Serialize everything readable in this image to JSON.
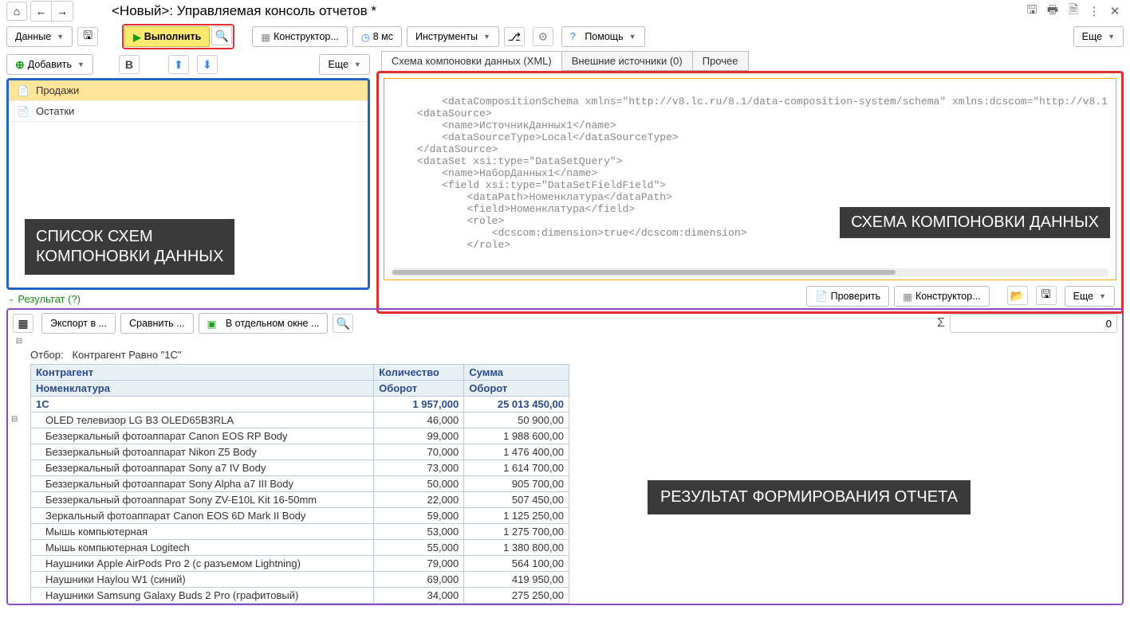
{
  "title": "<Новый>: Управляемая консоль отчетов *",
  "toolbar": {
    "data": "Данные",
    "execute": "Выполнить",
    "constructor": "Конструктор...",
    "time": "8 мс",
    "tools": "Инструменты",
    "help": "Помощь",
    "more": "Еще"
  },
  "leftbar": {
    "add": "Добавить",
    "bold": "B",
    "more": "Еще"
  },
  "schemas": [
    {
      "name": "Продажи",
      "selected": true
    },
    {
      "name": "Остатки",
      "selected": false
    }
  ],
  "overlay_left": "СПИСОК СХЕМ\nКОМПОНОВКИ ДАННЫХ",
  "tabs": {
    "xml": "Схема компоновки данных (XML)",
    "ext": "Внешние источники (0)",
    "other": "Прочее"
  },
  "xml": "<dataCompositionSchema xmlns=\"http://v8.lc.ru/8.1/data-composition-system/schema\" xmlns:dcscom=\"http://v8.1\n    <dataSource>\n        <name>ИсточникДанных1</name>\n        <dataSourceType>Local</dataSourceType>\n    </dataSource>\n    <dataSet xsi:type=\"DataSetQuery\">\n        <name>НаборДанных1</name>\n        <field xsi:type=\"DataSetFieldField\">\n            <dataPath>Номенклатура</dataPath>\n            <field>Номенклатура</field>\n            <role>\n                <dcscom:dimension>true</dcscom:dimension>\n            </role>",
  "overlay_right": "СХЕМА КОМПОНОВКИ ДАННЫХ",
  "xml_toolbar": {
    "check": "Проверить",
    "constructor": "Конструктор...",
    "more": "Еще"
  },
  "result_header": "Результат (?)",
  "result_toolbar": {
    "export": "Экспорт в ...",
    "compare": "Сравнить ...",
    "newwin": "В отдельном окне ...",
    "sum": "0"
  },
  "filter_label": "Отбор:",
  "filter_value": "Контрагент Равно \"1С\"",
  "headers": {
    "c1a": "Контрагент",
    "c1b": "Номенклатура",
    "c2a": "Количество",
    "c2b": "Оборот",
    "c3a": "Сумма",
    "c3b": "Оборот"
  },
  "group": {
    "name": "1С",
    "qty": "1 957,000",
    "sum": "25 013 450,00"
  },
  "rows": [
    {
      "n": "OLED телевизор LG B3 OLED65B3RLA",
      "q": "46,000",
      "s": "50 900,00"
    },
    {
      "n": "Беззеркальный фотоаппарат Canon EOS RP Body",
      "q": "99,000",
      "s": "1 988 600,00"
    },
    {
      "n": "Беззеркальный фотоаппарат Nikon Z5 Body",
      "q": "70,000",
      "s": "1 476 400,00"
    },
    {
      "n": "Беззеркальный фотоаппарат Sony a7 IV Body",
      "q": "73,000",
      "s": "1 614 700,00"
    },
    {
      "n": "Беззеркальный фотоаппарат Sony Alpha a7 III Body",
      "q": "50,000",
      "s": "905 700,00"
    },
    {
      "n": "Беззеркальный фотоаппарат Sony ZV-E10L Kit 16-50mm",
      "q": "22,000",
      "s": "507 450,00"
    },
    {
      "n": "Зеркальный фотоаппарат Canon EOS 6D Mark II Body",
      "q": "59,000",
      "s": "1 125 250,00"
    },
    {
      "n": "Мышь компьютерная",
      "q": "53,000",
      "s": "1 275 700,00"
    },
    {
      "n": "Мышь компьютерная Logitech",
      "q": "55,000",
      "s": "1 380 800,00"
    },
    {
      "n": "Наушники Apple AirPods Pro 2 (с разъемом Lightning)",
      "q": "79,000",
      "s": "564 100,00"
    },
    {
      "n": "Наушники Haylou W1 (синий)",
      "q": "69,000",
      "s": "419 950,00"
    },
    {
      "n": "Наушники Samsung Galaxy Buds 2 Pro (графитовый)",
      "q": "34,000",
      "s": "275 250,00"
    }
  ],
  "overlay_result": "РЕЗУЛЬТАТ ФОРМИРОВАНИЯ ОТЧЕТА"
}
